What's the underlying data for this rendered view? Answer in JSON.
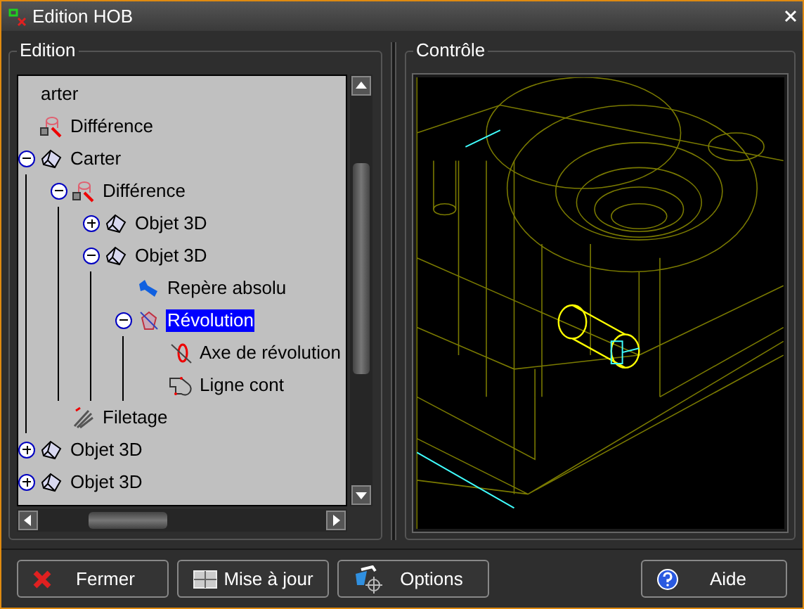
{
  "window": {
    "title": "Edition HOB"
  },
  "edition": {
    "title": "Edition",
    "tree": [
      {
        "label": "arter",
        "kind": "none",
        "selected": false
      },
      {
        "label": "Différence",
        "kind": "difference",
        "selected": false
      },
      {
        "label": "Carter",
        "kind": "solid",
        "expanded": true,
        "selected": false,
        "children": [
          {
            "label": "Différence",
            "kind": "difference",
            "expanded": true,
            "selected": false,
            "children": [
              {
                "label": "Objet 3D",
                "kind": "solid",
                "expanded": false,
                "selected": false
              },
              {
                "label": "Objet 3D",
                "kind": "solid",
                "expanded": true,
                "selected": false,
                "children": [
                  {
                    "label": "Repère absolu",
                    "kind": "frame",
                    "selected": false
                  },
                  {
                    "label": "Révolution",
                    "kind": "revolution",
                    "expanded": true,
                    "selected": true,
                    "children": [
                      {
                        "label": "Axe de révolution",
                        "kind": "axis",
                        "selected": false
                      },
                      {
                        "label": "Ligne cont",
                        "kind": "contour",
                        "selected": false
                      }
                    ]
                  }
                ]
              }
            ]
          },
          {
            "label": "Filetage",
            "kind": "thread",
            "selected": false
          }
        ]
      },
      {
        "label": "Objet 3D",
        "kind": "solid",
        "expanded": false,
        "selected": false
      },
      {
        "label": "Objet 3D",
        "kind": "solid",
        "expanded": false,
        "selected": false
      }
    ]
  },
  "control": {
    "title": "Contrôle"
  },
  "buttons": [
    {
      "label": "Fermer",
      "kind": "close"
    },
    {
      "label": "Mise à jour",
      "kind": "update"
    },
    {
      "label": "Options",
      "kind": "options"
    },
    {
      "label": "Aide",
      "kind": "help"
    }
  ]
}
